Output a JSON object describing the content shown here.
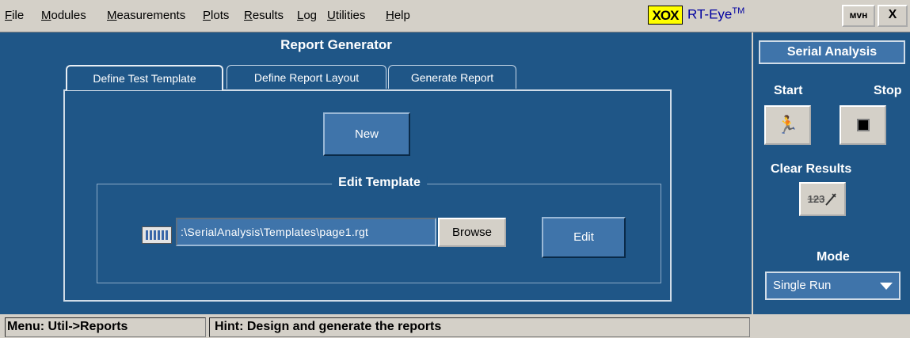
{
  "menubar": {
    "items": [
      {
        "label": "File",
        "ul": "F",
        "rest": "ile"
      },
      {
        "label": "Modules",
        "ul": "M",
        "rest": "odules"
      },
      {
        "label": "Measurements",
        "ul": "M",
        "rest": "easurements"
      },
      {
        "label": "Plots",
        "ul": "P",
        "rest": "lots"
      },
      {
        "label": "Results",
        "ul": "R",
        "rest": "esults"
      },
      {
        "label": "Log",
        "ul": "L",
        "rest": "og"
      },
      {
        "label": "Utilities",
        "ul": "U",
        "rest": "tilities"
      },
      {
        "label": "Help",
        "ul": "H",
        "rest": "elp"
      }
    ],
    "logo_text": "XOX",
    "product_name": "RT-Eye",
    "product_tm": "TM",
    "tek_button_label": "ᴍᴠʜ",
    "close_label": "X"
  },
  "main": {
    "title": "Report Generator",
    "tabs": [
      {
        "label": "Define Test Template",
        "active": true
      },
      {
        "label": "Define Report Layout",
        "active": false
      },
      {
        "label": "Generate Report",
        "active": false
      }
    ],
    "new_button": "New",
    "group_label": "Edit Template",
    "template_path": ":\\SerialAnalysis\\Templates\\page1.rgt",
    "browse_button": "Browse",
    "edit_button": "Edit"
  },
  "side": {
    "title": "Serial Analysis",
    "start_label": "Start",
    "stop_label": "Stop",
    "start_icon": "🏃",
    "clear_label": "Clear Results",
    "clear_icon_text": "123",
    "mode_label": "Mode",
    "mode_value": "Single Run"
  },
  "status": {
    "menu": "Menu: Util->Reports",
    "hint": "Hint: Design and generate the reports"
  },
  "colors": {
    "panel_blue": "#1f5687",
    "button_blue": "#3f74aa",
    "chrome_gray": "#d4d0c8",
    "logo_yellow": "#ffff00"
  }
}
